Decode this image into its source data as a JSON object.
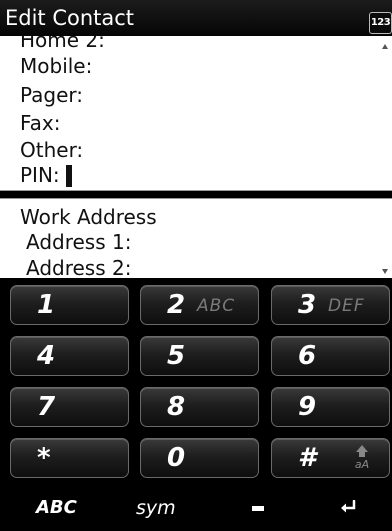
{
  "titlebar": {
    "title": "Edit Contact",
    "input_mode": "123"
  },
  "phone_fields": {
    "home2": "Home 2:",
    "mobile": "Mobile:",
    "pager": "Pager:",
    "fax": "Fax:",
    "other": "Other:",
    "pin": "PIN:"
  },
  "address_fields": {
    "section": "Work Address",
    "address1": "Address 1:",
    "address2": "Address 2:"
  },
  "keypad": {
    "keys": [
      {
        "digit": "1",
        "letters": ""
      },
      {
        "digit": "2",
        "letters": "ABC"
      },
      {
        "digit": "3",
        "letters": "DEF"
      },
      {
        "digit": "4",
        "letters": ""
      },
      {
        "digit": "5",
        "letters": ""
      },
      {
        "digit": "6",
        "letters": ""
      },
      {
        "digit": "7",
        "letters": ""
      },
      {
        "digit": "8",
        "letters": ""
      },
      {
        "digit": "9",
        "letters": ""
      },
      {
        "digit": "*",
        "letters": ""
      },
      {
        "digit": "0",
        "letters": ""
      },
      {
        "digit": "#",
        "letters": ""
      }
    ],
    "shift_label": "aA",
    "function_row": {
      "abc": "ABC",
      "sym": "sym",
      "space_icon": "space-icon",
      "enter_icon": "enter-icon"
    }
  },
  "colors": {
    "background": "#000000",
    "form_background": "#ffffff",
    "key_letters": "#7a7a7a"
  }
}
